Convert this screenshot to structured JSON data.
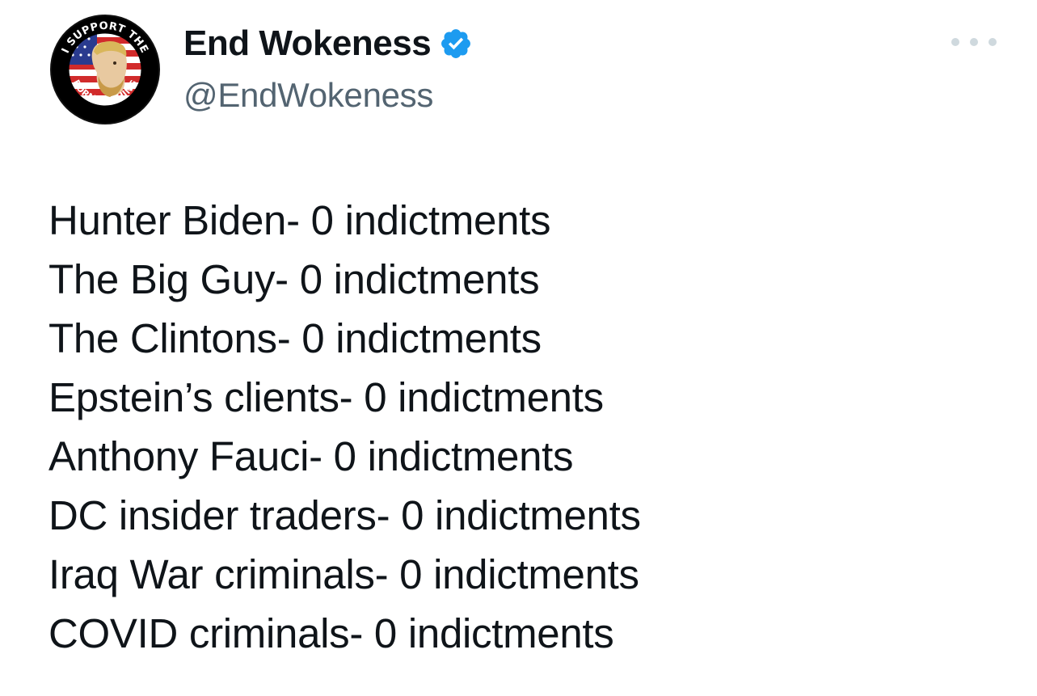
{
  "author": {
    "display_name": "End Wokeness",
    "handle": "@EndWokeness",
    "verified": true,
    "avatar_text_top": "I SUPPORT THE",
    "avatar_text_bottom": "FORMER THING"
  },
  "menu": {
    "icon": "more-horizontal-icon"
  },
  "tweet": {
    "lines": [
      "Hunter Biden- 0 indictments",
      "The Big Guy- 0 indictments",
      "The Clintons- 0 indictments",
      "Epstein’s clients- 0 indictments",
      "Anthony Fauci- 0 indictments",
      "DC insider traders- 0 indictments",
      "Iraq War criminals- 0 indictments",
      "COVID criminals- 0 indictments"
    ]
  },
  "colors": {
    "text_primary": "#0f1419",
    "text_secondary": "#536471",
    "verified_badge": "#1d9bf0",
    "menu_dots": "#cfd9de",
    "background": "#ffffff"
  }
}
